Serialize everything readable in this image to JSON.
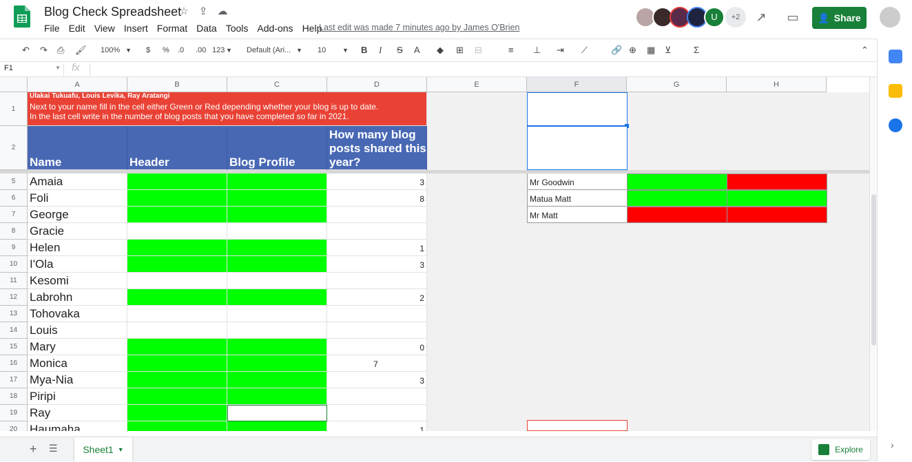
{
  "app": {
    "title": "Blog Check Spreadsheet",
    "menu": [
      "File",
      "Edit",
      "View",
      "Insert",
      "Format",
      "Data",
      "Tools",
      "Add-ons",
      "Help"
    ],
    "last_edit": "Last edit was made 7 minutes ago by James O'Brien",
    "collab_more": "+2",
    "collab_initial": "U",
    "share_label": "Share"
  },
  "toolbar": {
    "zoom": "100%",
    "currency": "$",
    "percent": "%",
    "dec_less": ".0",
    "dec_more": ".00",
    "format_num": "123",
    "font": "Default (Ari...",
    "size": "10",
    "bold": "B",
    "italic": "I",
    "strike": "S",
    "textcolor": "A"
  },
  "formula": {
    "namebox": "F1",
    "fx": "fx"
  },
  "columns": [
    "A",
    "B",
    "C",
    "D",
    "E",
    "F",
    "G",
    "H"
  ],
  "instructions": {
    "header": "Ulakai Tukuafu, Louis Levika, Ray Aratangi",
    "line1": "Next to your name fill in the cell either Green or Red depending whether your blog is up to date.",
    "line2": "In the last cell write in the number of blog posts that you have completed so far in 2021."
  },
  "headers": {
    "name": "Name",
    "header": "Header",
    "blog_profile": "Blog Profile",
    "posts": "How many blog posts shared this year?"
  },
  "rows": [
    {
      "num": "5",
      "name": "Amaia",
      "b": "green",
      "c": "green",
      "d": "3"
    },
    {
      "num": "6",
      "name": "Foli",
      "b": "green",
      "c": "green",
      "d": "8"
    },
    {
      "num": "7",
      "name": "George",
      "b": "green",
      "c": "green",
      "d": ""
    },
    {
      "num": "8",
      "name": "Gracie",
      "b": "",
      "c": "",
      "d": ""
    },
    {
      "num": "9",
      "name": "Helen",
      "b": "green",
      "c": "green",
      "d": "1"
    },
    {
      "num": "10",
      "name": "I'Ola",
      "b": "green",
      "c": "green",
      "d": "3"
    },
    {
      "num": "11",
      "name": "Kesomi",
      "b": "",
      "c": "",
      "d": ""
    },
    {
      "num": "12",
      "name": "Labrohn",
      "b": "green",
      "c": "green",
      "d": "2"
    },
    {
      "num": "13",
      "name": "Tohovaka",
      "b": "",
      "c": "",
      "d": ""
    },
    {
      "num": "14",
      "name": "Louis",
      "b": "",
      "c": "",
      "d": ""
    },
    {
      "num": "15",
      "name": "Mary",
      "b": "green",
      "c": "green",
      "d": "0"
    },
    {
      "num": "16",
      "name": "Monica",
      "b": "green",
      "c": "green",
      "d": "7"
    },
    {
      "num": "17",
      "name": "Mya-Nia",
      "b": "green",
      "c": "green",
      "d": "3"
    },
    {
      "num": "18",
      "name": "Piripi",
      "b": "green",
      "c": "green",
      "d": ""
    },
    {
      "num": "19",
      "name": "Ray",
      "b": "green",
      "c": "",
      "d": ""
    },
    {
      "num": "20",
      "name": "Haumaha",
      "b": "green",
      "c": "green",
      "d": "1"
    }
  ],
  "teachers": [
    {
      "name": "Mr Goodwin",
      "g": "green",
      "h": "red"
    },
    {
      "name": "Matua Matt",
      "g": "green",
      "h": "green"
    },
    {
      "name": "Mr Matt",
      "g": "red",
      "h": "red"
    }
  ],
  "sheet": {
    "tab": "Sheet1",
    "explore": "Explore"
  },
  "colors": {
    "green": "#00ff00",
    "red": "#ff0000",
    "header_blue": "#4868b4",
    "instructions_red": "#e94235"
  }
}
